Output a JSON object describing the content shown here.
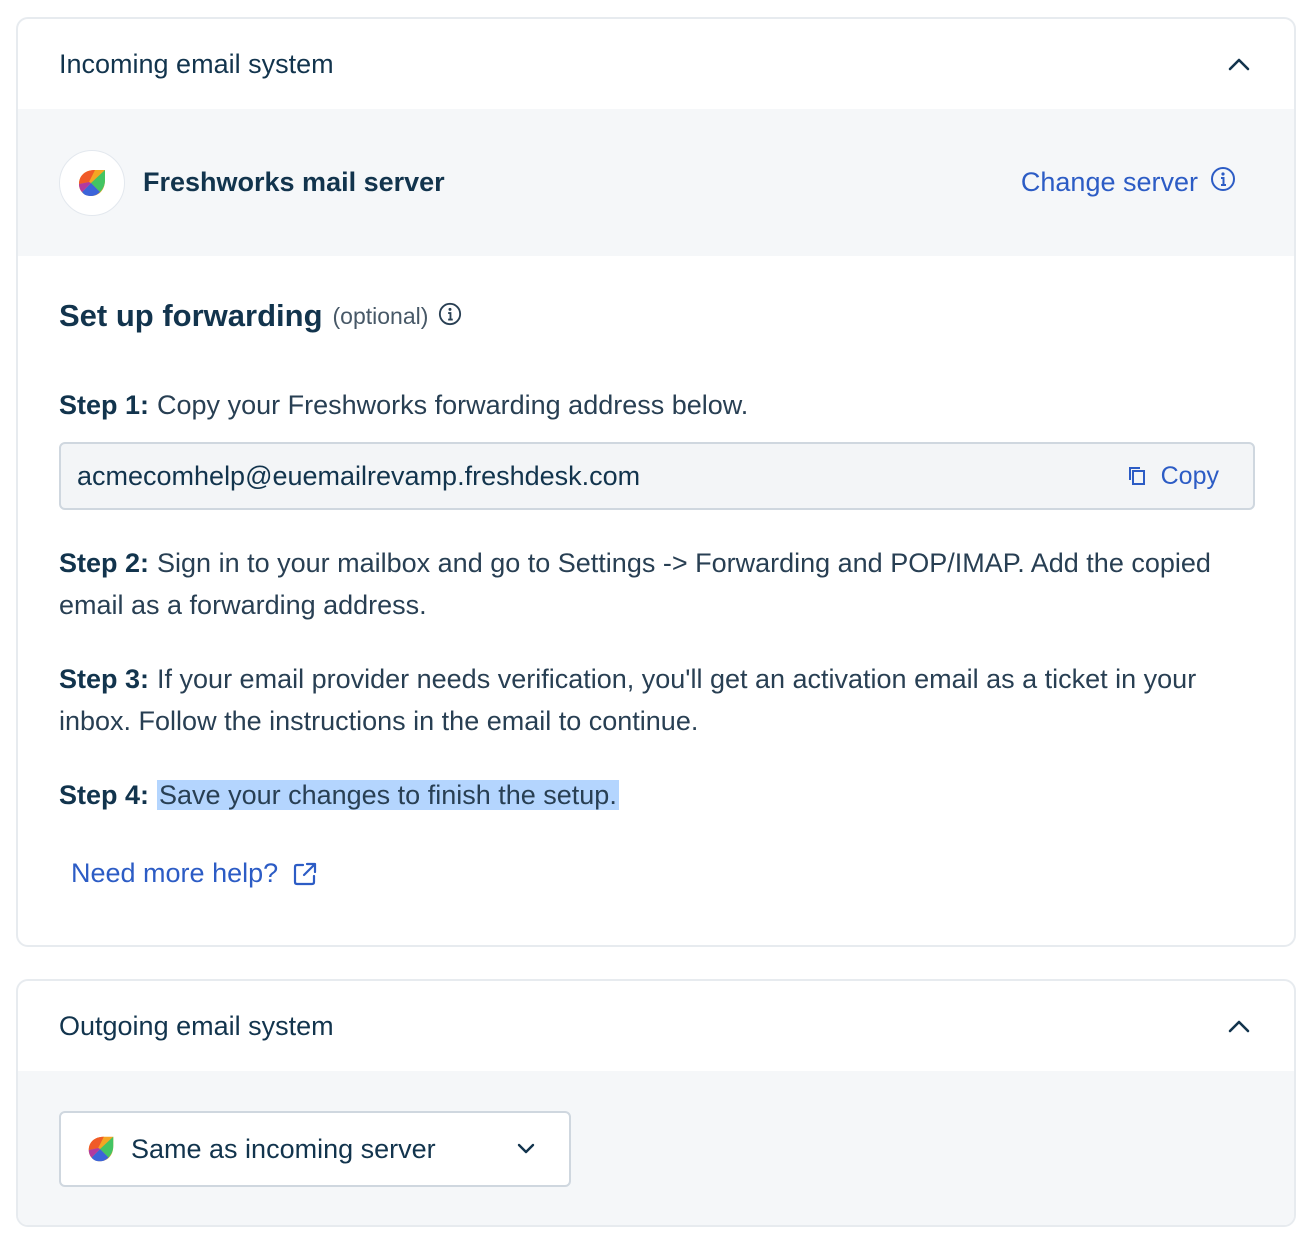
{
  "incoming": {
    "title": "Incoming email system",
    "server_name": "Freshworks mail server",
    "change_server_label": "Change server",
    "forwarding": {
      "title": "Set up forwarding",
      "optional": "(optional)",
      "step1_label": "Step 1:",
      "step1_text": "Copy your Freshworks forwarding address below.",
      "address": "acmecomhelp@euemailrevamp.freshdesk.com",
      "copy_label": "Copy",
      "step2_label": "Step 2:",
      "step2_text": "Sign in to your mailbox and go to Settings -> Forwarding and POP/IMAP. Add the copied email as a forwarding address.",
      "step3_label": "Step 3:",
      "step3_text": "If your email provider needs verification, you'll get an activation email as a ticket in your inbox. Follow the instructions in the email to continue.",
      "step4_label": "Step 4:",
      "step4_text": "Save your changes to finish the setup.",
      "help_label": "Need more help?"
    }
  },
  "outgoing": {
    "title": "Outgoing email system",
    "selected_server": "Same as incoming server"
  },
  "colors": {
    "primary_text": "#12344d",
    "link": "#2c5cc5",
    "band_background": "#f5f7f9",
    "selection_highlight": "#b4d5fe"
  },
  "icons": [
    "freshworks-logo-icon",
    "chevron-up-icon",
    "info-icon",
    "copy-icon",
    "external-link-icon",
    "chevron-down-icon"
  ]
}
